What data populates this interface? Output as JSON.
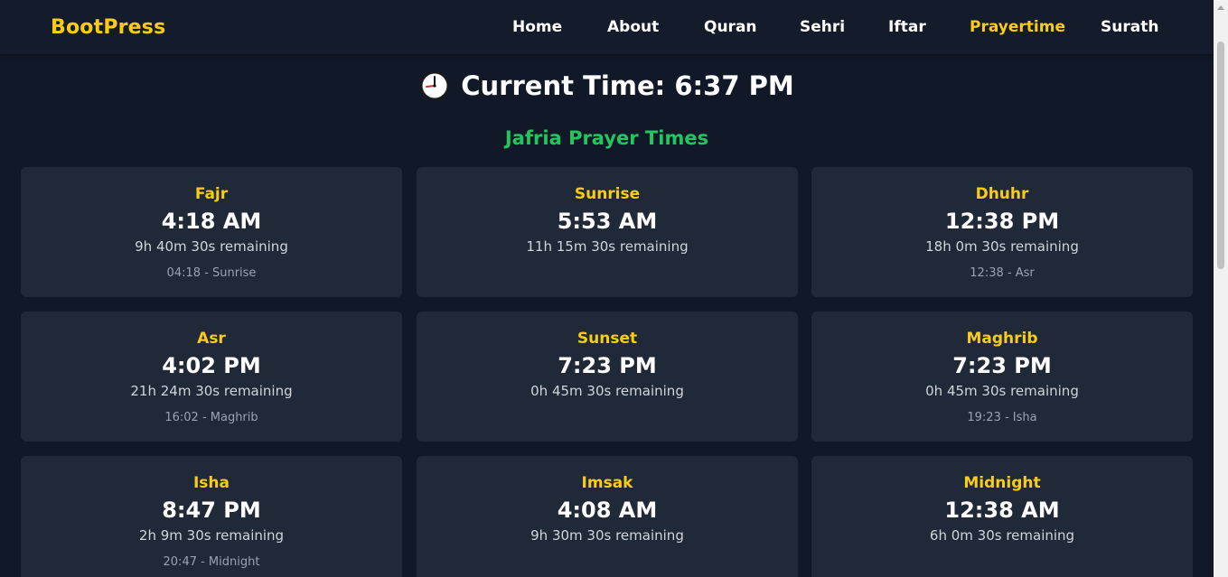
{
  "navbar": {
    "brand": "BootPress",
    "links": [
      {
        "label": "Home",
        "active": false
      },
      {
        "label": "About",
        "active": false
      },
      {
        "label": "Quran",
        "active": false
      },
      {
        "label": "Sehri",
        "active": false
      },
      {
        "label": "Iftar",
        "active": false
      },
      {
        "label": "Prayertime",
        "active": true
      },
      {
        "label": "Surath",
        "active": false
      }
    ]
  },
  "header": {
    "current_time": "Current Time: 6:37 PM",
    "clock_icon": "clock-icon"
  },
  "section_title": "Jafria Prayer Times",
  "prayers": [
    {
      "name": "Fajr",
      "time": "4:18 AM",
      "remaining": "9h 40m 30s remaining",
      "range": "04:18 - Sunrise"
    },
    {
      "name": "Sunrise",
      "time": "5:53 AM",
      "remaining": "11h 15m 30s remaining",
      "range": ""
    },
    {
      "name": "Dhuhr",
      "time": "12:38 PM",
      "remaining": "18h 0m 30s remaining",
      "range": "12:38 - Asr"
    },
    {
      "name": "Asr",
      "time": "4:02 PM",
      "remaining": "21h 24m 30s remaining",
      "range": "16:02 - Maghrib"
    },
    {
      "name": "Sunset",
      "time": "7:23 PM",
      "remaining": "0h 45m 30s remaining",
      "range": ""
    },
    {
      "name": "Maghrib",
      "time": "7:23 PM",
      "remaining": "0h 45m 30s remaining",
      "range": "19:23 - Isha"
    },
    {
      "name": "Isha",
      "time": "8:47 PM",
      "remaining": "2h 9m 30s remaining",
      "range": "20:47 - Midnight"
    },
    {
      "name": "Imsak",
      "time": "4:08 AM",
      "remaining": "9h 30m 30s remaining",
      "range": ""
    },
    {
      "name": "Midnight",
      "time": "12:38 AM",
      "remaining": "6h 0m 30s remaining",
      "range": ""
    }
  ],
  "colors": {
    "accent": "#facc15",
    "title_green": "#22c55e",
    "background": "#111827",
    "card": "#1f2937"
  }
}
